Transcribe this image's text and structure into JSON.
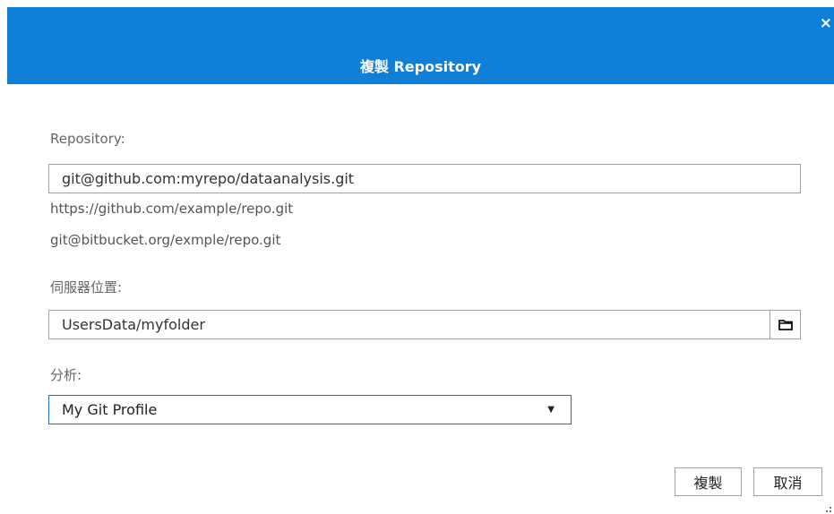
{
  "dialog": {
    "title": "複製 Repository",
    "close_label": "×"
  },
  "repository": {
    "label": "Repository:",
    "value": "git@github.com:myrepo/dataanalysis.git",
    "suggestions": [
      "https://github.com/example/repo.git",
      "git@bitbucket.org/exmple/repo.git"
    ]
  },
  "server_location": {
    "label": "伺服器位置:",
    "value": "UsersData/myfolder",
    "browse_icon": "folder-icon"
  },
  "profile": {
    "label": "分析:",
    "selected": "My Git Profile",
    "caret_icon": "triangle-down-icon"
  },
  "buttons": {
    "clone_label": "複製",
    "cancel_label": "取消"
  },
  "colors": {
    "titlebar": "#0f7fd8",
    "select_border": "#1f6cc2"
  }
}
